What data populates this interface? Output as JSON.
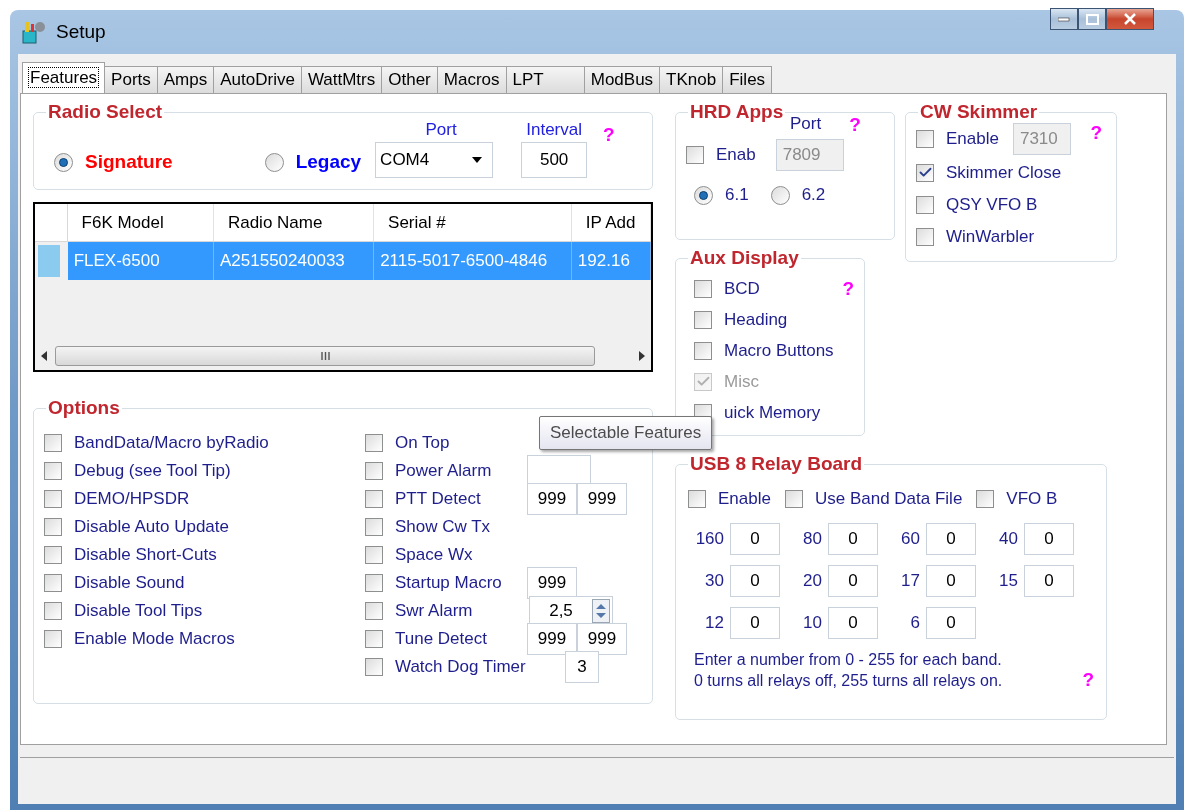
{
  "window": {
    "title": "Setup"
  },
  "tabs": [
    {
      "label": "Features",
      "selected": true
    },
    {
      "label": "Ports",
      "selected": false
    },
    {
      "label": "Amps",
      "selected": false
    },
    {
      "label": "AutoDrive",
      "selected": false
    },
    {
      "label": "WattMtrs",
      "selected": false
    },
    {
      "label": "Other",
      "selected": false
    },
    {
      "label": "Macros",
      "selected": false
    },
    {
      "label": "LPT",
      "selected": false
    },
    {
      "label": "ModBus",
      "selected": false
    },
    {
      "label": "TKnob",
      "selected": false
    },
    {
      "label": "Files",
      "selected": false
    }
  ],
  "radio_select": {
    "title": "Radio Select",
    "port_label": "Port",
    "interval_label": "Interval",
    "help": "?",
    "radios": [
      {
        "label": "Signature",
        "selected": true,
        "color": "#ff0000"
      },
      {
        "label": "Legacy",
        "selected": false,
        "color": "#0000ff"
      }
    ],
    "port": {
      "value": "COM4"
    },
    "interval": {
      "value": "500"
    }
  },
  "radio_table": {
    "columns": [
      "F6K Model",
      "Radio Name",
      "Serial #",
      "IP Add"
    ],
    "rows": [
      {
        "selected": true,
        "cells": [
          "FLEX-6500",
          "A251550240033",
          "2115-5017-6500-4846",
          "192.16"
        ]
      }
    ]
  },
  "options": {
    "title": "Options",
    "left": [
      {
        "label": "BandData/Macro byRadio",
        "checked": false
      },
      {
        "label": "Debug (see Tool Tip)",
        "checked": false
      },
      {
        "label": "DEMO/HPSDR",
        "checked": false
      },
      {
        "label": "Disable Auto Update",
        "checked": false
      },
      {
        "label": "Disable Short-Cuts",
        "checked": false
      },
      {
        "label": "Disable Sound",
        "checked": false
      },
      {
        "label": "Disable Tool Tips",
        "checked": false
      },
      {
        "label": "Enable Mode Macros",
        "checked": false
      }
    ],
    "right": [
      {
        "label": "On Top",
        "checked": false,
        "kind": "plain"
      },
      {
        "label": "Power Alarm",
        "checked": false,
        "kind": "blank_field"
      },
      {
        "label": "PTT Detect",
        "checked": false,
        "kind": "fields",
        "fields": [
          "999",
          "999"
        ]
      },
      {
        "label": "Show Cw Tx",
        "checked": false,
        "kind": "plain"
      },
      {
        "label": "Space Wx",
        "checked": false,
        "kind": "plain"
      },
      {
        "label": "Startup Macro",
        "checked": false,
        "kind": "fields",
        "fields": [
          "999"
        ]
      },
      {
        "label": "Swr Alarm",
        "checked": false,
        "kind": "spinner",
        "value": "2,5"
      },
      {
        "label": "Tune Detect",
        "checked": false,
        "kind": "fields",
        "fields": [
          "999",
          "999"
        ]
      },
      {
        "label": "Watch Dog Timer",
        "checked": false,
        "kind": "small_field",
        "fields": [
          "3"
        ]
      }
    ]
  },
  "hrd_apps": {
    "title": "HRD Apps",
    "port_label": "Port",
    "help": "?",
    "enable": {
      "label": "Enab",
      "checked": false
    },
    "port": {
      "value": "7809",
      "disabled": true
    },
    "versions": [
      {
        "label": "6.1",
        "selected": true
      },
      {
        "label": "6.2",
        "selected": false
      }
    ]
  },
  "cw_skimmer": {
    "title": "CW Skimmer",
    "help": "?",
    "items": [
      {
        "label": "Enable",
        "checked": false,
        "port": "7310"
      },
      {
        "label": "Skimmer Close",
        "checked": true
      },
      {
        "label": "QSY VFO B",
        "checked": false
      },
      {
        "label": "WinWarbler",
        "checked": false
      }
    ]
  },
  "aux_display": {
    "title": "Aux Display",
    "help": "?",
    "items": [
      {
        "label": "BCD",
        "checked": false,
        "disabled": false
      },
      {
        "label": "Heading",
        "checked": false,
        "disabled": false
      },
      {
        "label": "Macro Buttons",
        "checked": false,
        "disabled": false
      },
      {
        "label": "Misc",
        "checked": true,
        "disabled": true
      },
      {
        "label": "uick Memory",
        "checked": false,
        "disabled": false
      }
    ]
  },
  "usb_relay": {
    "title": "USB 8 Relay Board",
    "help": "?",
    "options": [
      {
        "label": "Enable",
        "checked": false
      },
      {
        "label": "Use Band Data File",
        "checked": false
      },
      {
        "label": "VFO B",
        "checked": false
      }
    ],
    "bands": [
      [
        {
          "band": "160",
          "value": "0"
        },
        {
          "band": "80",
          "value": "0"
        },
        {
          "band": "60",
          "value": "0"
        },
        {
          "band": "40",
          "value": "0"
        }
      ],
      [
        {
          "band": "30",
          "value": "0"
        },
        {
          "band": "20",
          "value": "0"
        },
        {
          "band": "17",
          "value": "0"
        },
        {
          "band": "15",
          "value": "0"
        }
      ],
      [
        {
          "band": "12",
          "value": "0"
        },
        {
          "band": "10",
          "value": "0"
        },
        {
          "band": "6",
          "value": "0"
        }
      ]
    ],
    "note_lines": [
      "Enter a number from 0 - 255 for each band.",
      "0 turns all relays off, 255 turns all relays on."
    ]
  },
  "tooltip": {
    "text": "Selectable Features"
  }
}
